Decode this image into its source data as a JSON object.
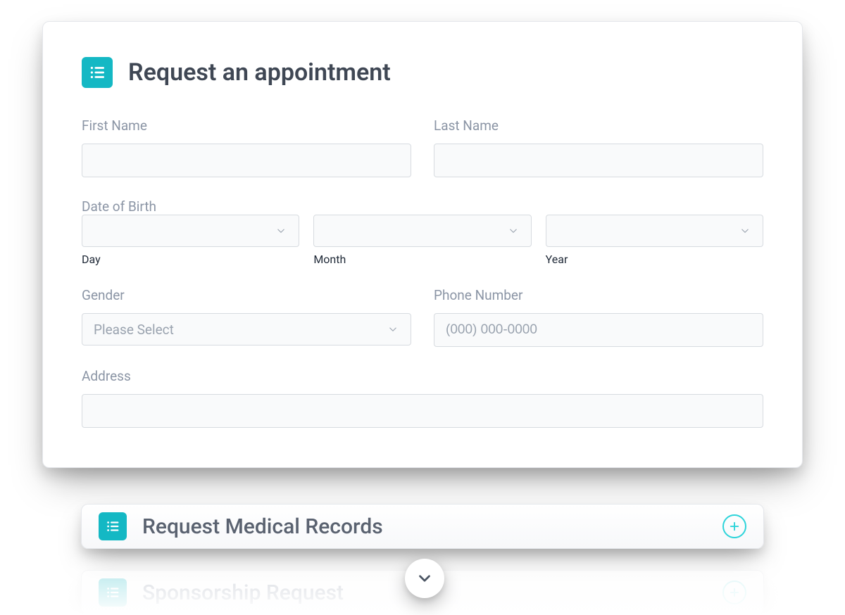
{
  "form": {
    "title": "Request an appointment",
    "first_name_label": "First Name",
    "last_name_label": "Last Name",
    "dob_label": "Date of Birth",
    "dob_day_label": "Day",
    "dob_month_label": "Month",
    "dob_year_label": "Year",
    "gender_label": "Gender",
    "gender_placeholder": "Please Select",
    "phone_label": "Phone Number",
    "phone_placeholder": "(000) 000-0000",
    "address_label": "Address"
  },
  "accordions": [
    {
      "title": "Request Medical Records"
    },
    {
      "title": "Sponsorship Request"
    }
  ]
}
